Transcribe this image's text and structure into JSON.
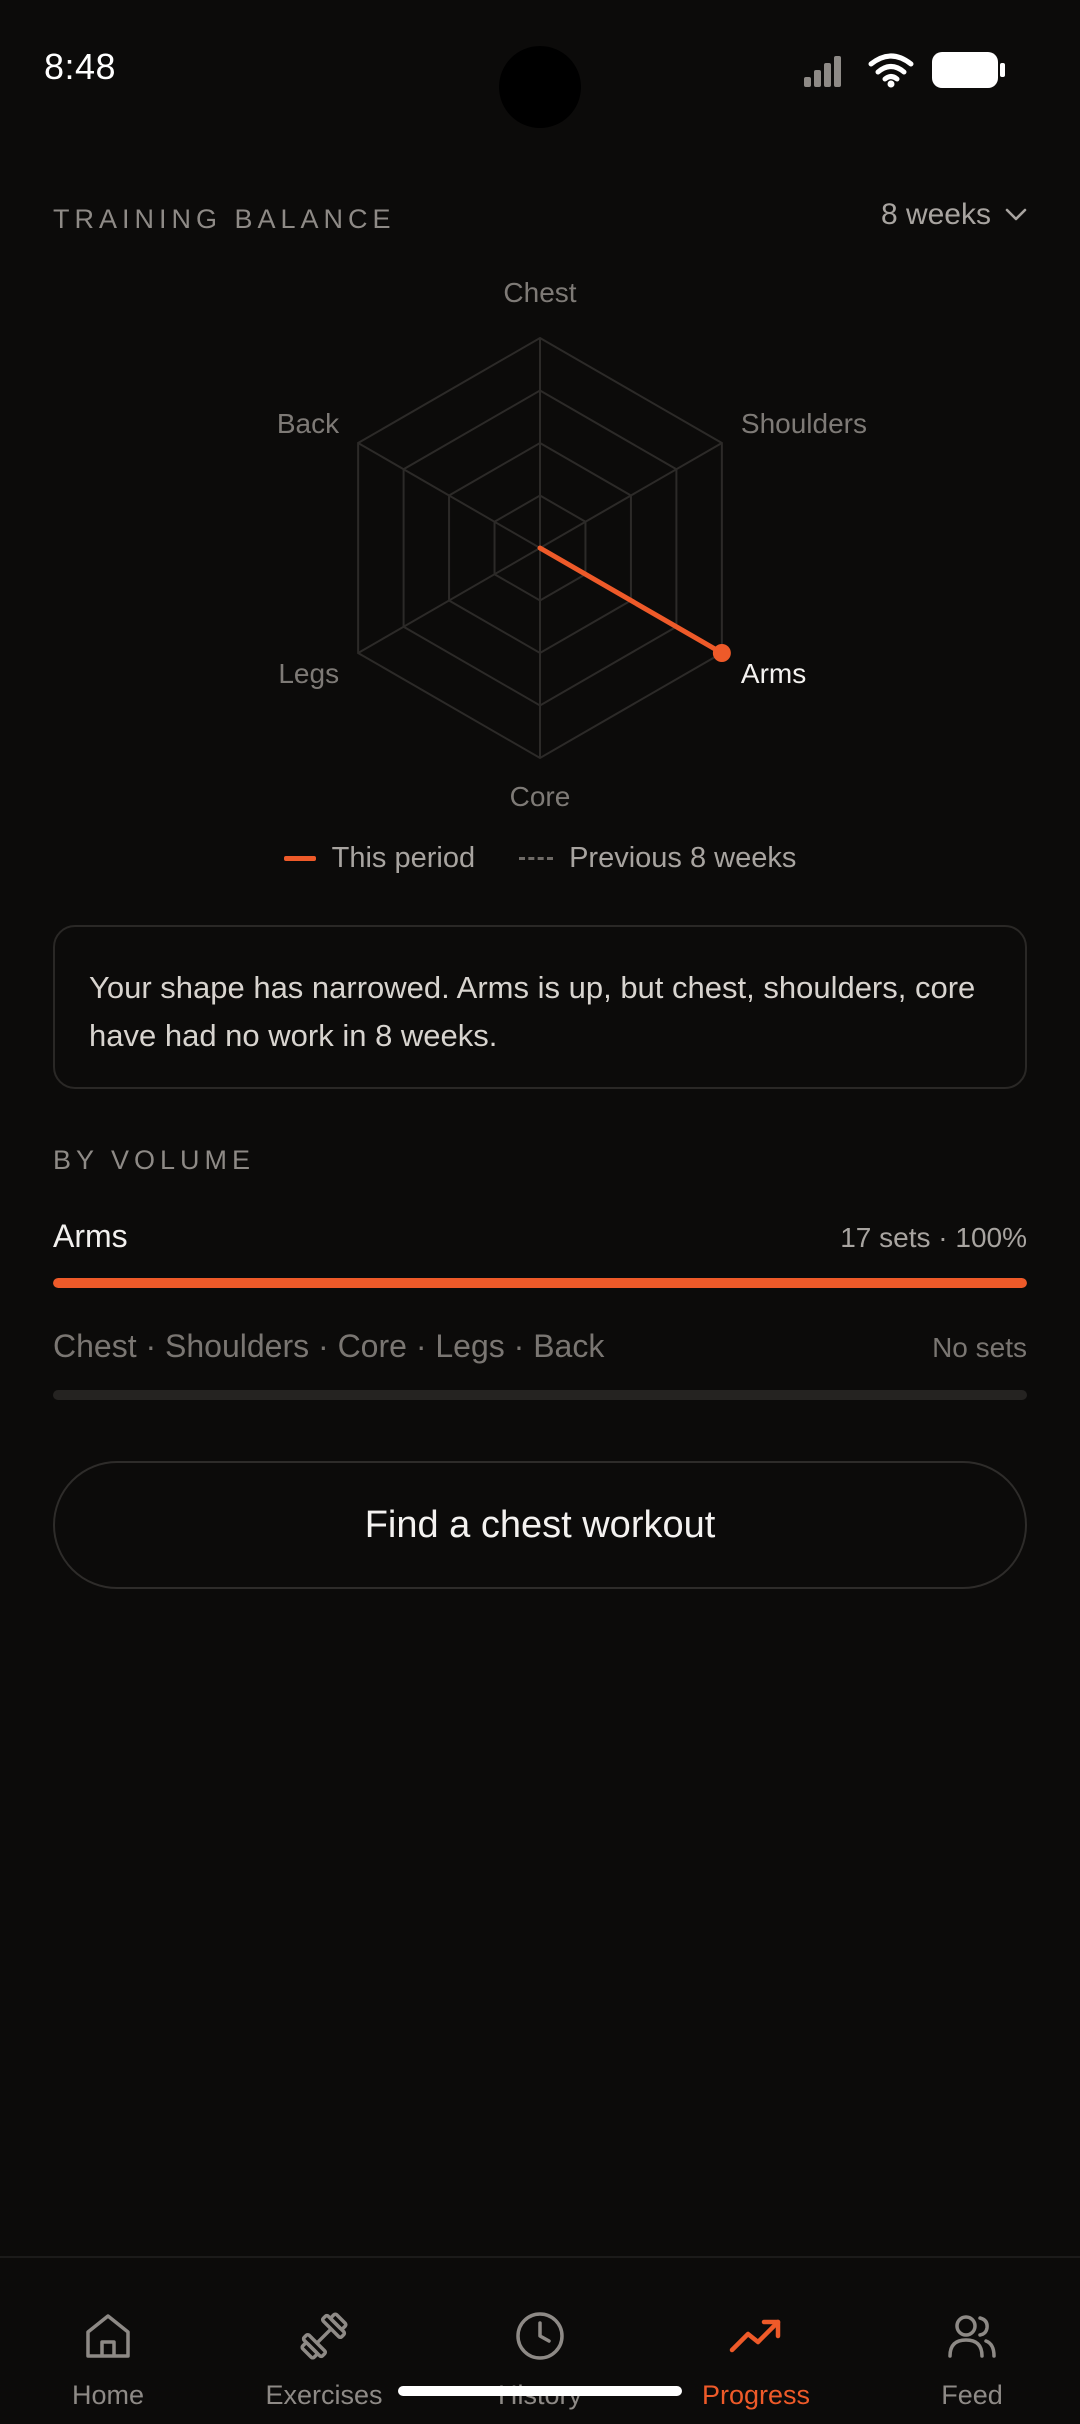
{
  "status_bar": {
    "time": "8:48"
  },
  "header": {
    "title": "TRAINING BALANCE",
    "range": "8 weeks"
  },
  "chart_data": {
    "type": "radar",
    "axes": [
      "Chest",
      "Shoulders",
      "Arms",
      "Core",
      "Legs",
      "Back"
    ],
    "series": [
      {
        "name": "This period",
        "values": [
          0,
          0,
          1.0,
          0,
          0,
          0
        ]
      },
      {
        "name": "Previous 8 weeks",
        "values": [
          0,
          0,
          0,
          0,
          0,
          0
        ]
      }
    ],
    "highlight_axis": "Arms",
    "rings": 4,
    "colors": {
      "current": "#ee5a29",
      "previous": "#6e6a66",
      "grid": "#2c2a28"
    }
  },
  "legend": {
    "current_label": "This period",
    "previous_label": "Previous 8 weeks"
  },
  "insight": {
    "text": "Your shape has narrowed. Arms is up, but chest, shoulders, core have had no work in 8 weeks."
  },
  "volume": {
    "title": "BY VOLUME",
    "rows": [
      {
        "name": "Arms",
        "meta": "17 sets · 100%",
        "fraction": 1.0
      },
      {
        "name": "Chest · Shoulders · Core · Legs · Back",
        "meta": "No sets",
        "fraction": 0.0
      }
    ]
  },
  "cta": {
    "label": "Find a chest workout"
  },
  "nav": {
    "items": [
      {
        "label": "Home",
        "icon": "home-icon"
      },
      {
        "label": "Exercises",
        "icon": "dumbbell-icon"
      },
      {
        "label": "History",
        "icon": "clock-icon"
      },
      {
        "label": "Progress",
        "icon": "trending-up-icon",
        "active": true
      },
      {
        "label": "Feed",
        "icon": "users-icon"
      }
    ]
  }
}
